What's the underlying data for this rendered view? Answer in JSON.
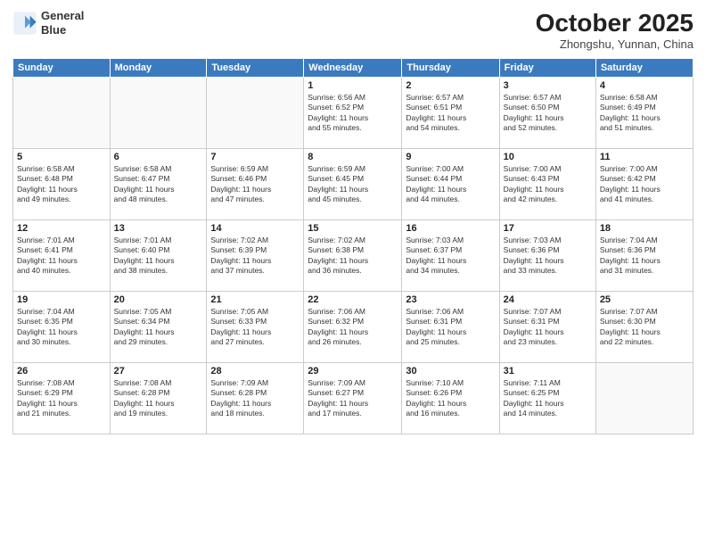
{
  "header": {
    "logo_line1": "General",
    "logo_line2": "Blue",
    "month": "October 2025",
    "location": "Zhongshu, Yunnan, China"
  },
  "weekdays": [
    "Sunday",
    "Monday",
    "Tuesday",
    "Wednesday",
    "Thursday",
    "Friday",
    "Saturday"
  ],
  "weeks": [
    [
      {
        "day": "",
        "info": ""
      },
      {
        "day": "",
        "info": ""
      },
      {
        "day": "",
        "info": ""
      },
      {
        "day": "1",
        "info": "Sunrise: 6:56 AM\nSunset: 6:52 PM\nDaylight: 11 hours\nand 55 minutes."
      },
      {
        "day": "2",
        "info": "Sunrise: 6:57 AM\nSunset: 6:51 PM\nDaylight: 11 hours\nand 54 minutes."
      },
      {
        "day": "3",
        "info": "Sunrise: 6:57 AM\nSunset: 6:50 PM\nDaylight: 11 hours\nand 52 minutes."
      },
      {
        "day": "4",
        "info": "Sunrise: 6:58 AM\nSunset: 6:49 PM\nDaylight: 11 hours\nand 51 minutes."
      }
    ],
    [
      {
        "day": "5",
        "info": "Sunrise: 6:58 AM\nSunset: 6:48 PM\nDaylight: 11 hours\nand 49 minutes."
      },
      {
        "day": "6",
        "info": "Sunrise: 6:58 AM\nSunset: 6:47 PM\nDaylight: 11 hours\nand 48 minutes."
      },
      {
        "day": "7",
        "info": "Sunrise: 6:59 AM\nSunset: 6:46 PM\nDaylight: 11 hours\nand 47 minutes."
      },
      {
        "day": "8",
        "info": "Sunrise: 6:59 AM\nSunset: 6:45 PM\nDaylight: 11 hours\nand 45 minutes."
      },
      {
        "day": "9",
        "info": "Sunrise: 7:00 AM\nSunset: 6:44 PM\nDaylight: 11 hours\nand 44 minutes."
      },
      {
        "day": "10",
        "info": "Sunrise: 7:00 AM\nSunset: 6:43 PM\nDaylight: 11 hours\nand 42 minutes."
      },
      {
        "day": "11",
        "info": "Sunrise: 7:00 AM\nSunset: 6:42 PM\nDaylight: 11 hours\nand 41 minutes."
      }
    ],
    [
      {
        "day": "12",
        "info": "Sunrise: 7:01 AM\nSunset: 6:41 PM\nDaylight: 11 hours\nand 40 minutes."
      },
      {
        "day": "13",
        "info": "Sunrise: 7:01 AM\nSunset: 6:40 PM\nDaylight: 11 hours\nand 38 minutes."
      },
      {
        "day": "14",
        "info": "Sunrise: 7:02 AM\nSunset: 6:39 PM\nDaylight: 11 hours\nand 37 minutes."
      },
      {
        "day": "15",
        "info": "Sunrise: 7:02 AM\nSunset: 6:38 PM\nDaylight: 11 hours\nand 36 minutes."
      },
      {
        "day": "16",
        "info": "Sunrise: 7:03 AM\nSunset: 6:37 PM\nDaylight: 11 hours\nand 34 minutes."
      },
      {
        "day": "17",
        "info": "Sunrise: 7:03 AM\nSunset: 6:36 PM\nDaylight: 11 hours\nand 33 minutes."
      },
      {
        "day": "18",
        "info": "Sunrise: 7:04 AM\nSunset: 6:36 PM\nDaylight: 11 hours\nand 31 minutes."
      }
    ],
    [
      {
        "day": "19",
        "info": "Sunrise: 7:04 AM\nSunset: 6:35 PM\nDaylight: 11 hours\nand 30 minutes."
      },
      {
        "day": "20",
        "info": "Sunrise: 7:05 AM\nSunset: 6:34 PM\nDaylight: 11 hours\nand 29 minutes."
      },
      {
        "day": "21",
        "info": "Sunrise: 7:05 AM\nSunset: 6:33 PM\nDaylight: 11 hours\nand 27 minutes."
      },
      {
        "day": "22",
        "info": "Sunrise: 7:06 AM\nSunset: 6:32 PM\nDaylight: 11 hours\nand 26 minutes."
      },
      {
        "day": "23",
        "info": "Sunrise: 7:06 AM\nSunset: 6:31 PM\nDaylight: 11 hours\nand 25 minutes."
      },
      {
        "day": "24",
        "info": "Sunrise: 7:07 AM\nSunset: 6:31 PM\nDaylight: 11 hours\nand 23 minutes."
      },
      {
        "day": "25",
        "info": "Sunrise: 7:07 AM\nSunset: 6:30 PM\nDaylight: 11 hours\nand 22 minutes."
      }
    ],
    [
      {
        "day": "26",
        "info": "Sunrise: 7:08 AM\nSunset: 6:29 PM\nDaylight: 11 hours\nand 21 minutes."
      },
      {
        "day": "27",
        "info": "Sunrise: 7:08 AM\nSunset: 6:28 PM\nDaylight: 11 hours\nand 19 minutes."
      },
      {
        "day": "28",
        "info": "Sunrise: 7:09 AM\nSunset: 6:28 PM\nDaylight: 11 hours\nand 18 minutes."
      },
      {
        "day": "29",
        "info": "Sunrise: 7:09 AM\nSunset: 6:27 PM\nDaylight: 11 hours\nand 17 minutes."
      },
      {
        "day": "30",
        "info": "Sunrise: 7:10 AM\nSunset: 6:26 PM\nDaylight: 11 hours\nand 16 minutes."
      },
      {
        "day": "31",
        "info": "Sunrise: 7:11 AM\nSunset: 6:25 PM\nDaylight: 11 hours\nand 14 minutes."
      },
      {
        "day": "",
        "info": ""
      }
    ]
  ]
}
